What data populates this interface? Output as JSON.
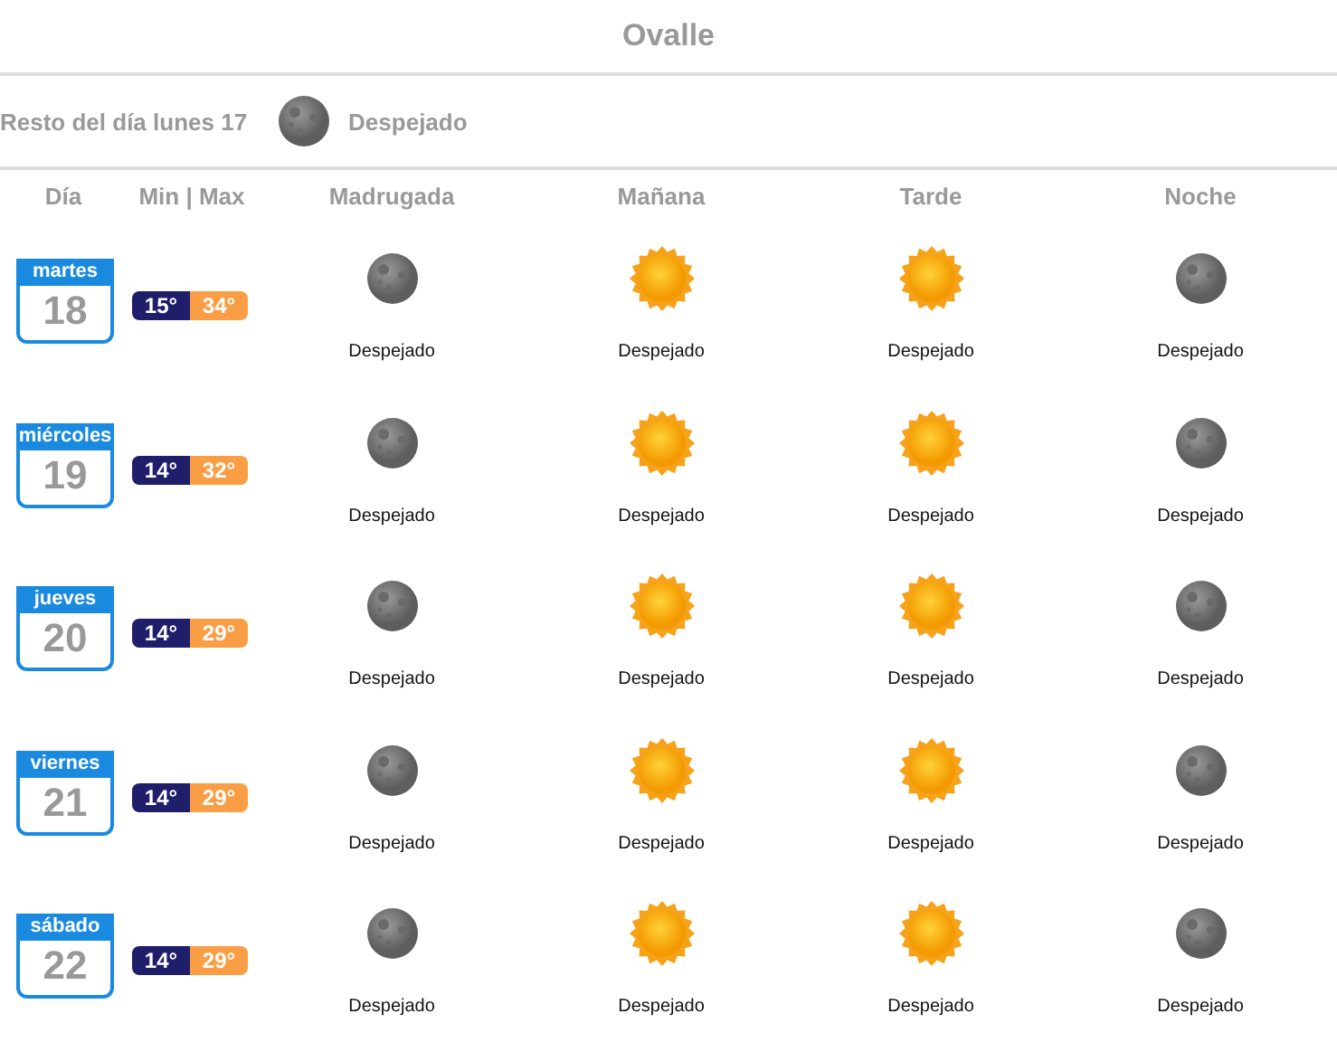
{
  "title": "Ovalle",
  "rest_of_day": {
    "label": "Resto del día lunes 17",
    "kind": "moon",
    "condition": "Despejado"
  },
  "columns": [
    "Día",
    "Min | Max",
    "Madrugada",
    "Mañana",
    "Tarde",
    "Noche"
  ],
  "days": [
    {
      "weekday": "martes",
      "date": "18",
      "min": "15°",
      "max": "34°",
      "periods": [
        {
          "kind": "moon",
          "condition": "Despejado"
        },
        {
          "kind": "sun",
          "condition": "Despejado"
        },
        {
          "kind": "sun",
          "condition": "Despejado"
        },
        {
          "kind": "moon",
          "condition": "Despejado"
        }
      ]
    },
    {
      "weekday": "miércoles",
      "date": "19",
      "min": "14°",
      "max": "32°",
      "periods": [
        {
          "kind": "moon",
          "condition": "Despejado"
        },
        {
          "kind": "sun",
          "condition": "Despejado"
        },
        {
          "kind": "sun",
          "condition": "Despejado"
        },
        {
          "kind": "moon",
          "condition": "Despejado"
        }
      ]
    },
    {
      "weekday": "jueves",
      "date": "20",
      "min": "14°",
      "max": "29°",
      "periods": [
        {
          "kind": "moon",
          "condition": "Despejado"
        },
        {
          "kind": "sun",
          "condition": "Despejado"
        },
        {
          "kind": "sun",
          "condition": "Despejado"
        },
        {
          "kind": "moon",
          "condition": "Despejado"
        }
      ]
    },
    {
      "weekday": "viernes",
      "date": "21",
      "min": "14°",
      "max": "29°",
      "periods": [
        {
          "kind": "moon",
          "condition": "Despejado"
        },
        {
          "kind": "sun",
          "condition": "Despejado"
        },
        {
          "kind": "sun",
          "condition": "Despejado"
        },
        {
          "kind": "moon",
          "condition": "Despejado"
        }
      ]
    },
    {
      "weekday": "sábado",
      "date": "22",
      "min": "14°",
      "max": "29°",
      "periods": [
        {
          "kind": "moon",
          "condition": "Despejado"
        },
        {
          "kind": "sun",
          "condition": "Despejado"
        },
        {
          "kind": "sun",
          "condition": "Despejado"
        },
        {
          "kind": "moon",
          "condition": "Despejado"
        }
      ]
    }
  ]
}
